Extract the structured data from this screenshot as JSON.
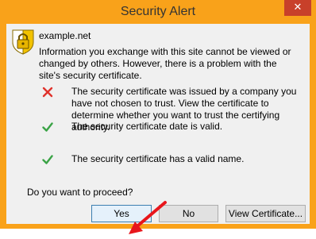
{
  "window": {
    "title": "Security Alert",
    "close_label": "✕"
  },
  "dialog": {
    "site": "example.net",
    "intro": "Information you exchange with this site cannot be viewed or changed by others. However, there is a problem with the site's security certificate.",
    "items": [
      {
        "status": "error",
        "icon": "red-x-icon",
        "text": "The security certificate was issued by a company you have not chosen to trust. View the certificate to determine whether you want to trust the certifying authority."
      },
      {
        "status": "ok",
        "icon": "green-check-icon",
        "text": "The security certificate date is valid."
      },
      {
        "status": "ok",
        "icon": "green-check-icon",
        "text": "The security certificate has a valid name."
      }
    ],
    "question": "Do you want to proceed?"
  },
  "buttons": {
    "yes": "Yes",
    "no": "No",
    "view": "View Certificate..."
  },
  "colors": {
    "frame": "#f9a21a",
    "close": "#c8402a",
    "error": "#e0322b",
    "ok": "#3aa346",
    "arrow": "#e8161c"
  }
}
